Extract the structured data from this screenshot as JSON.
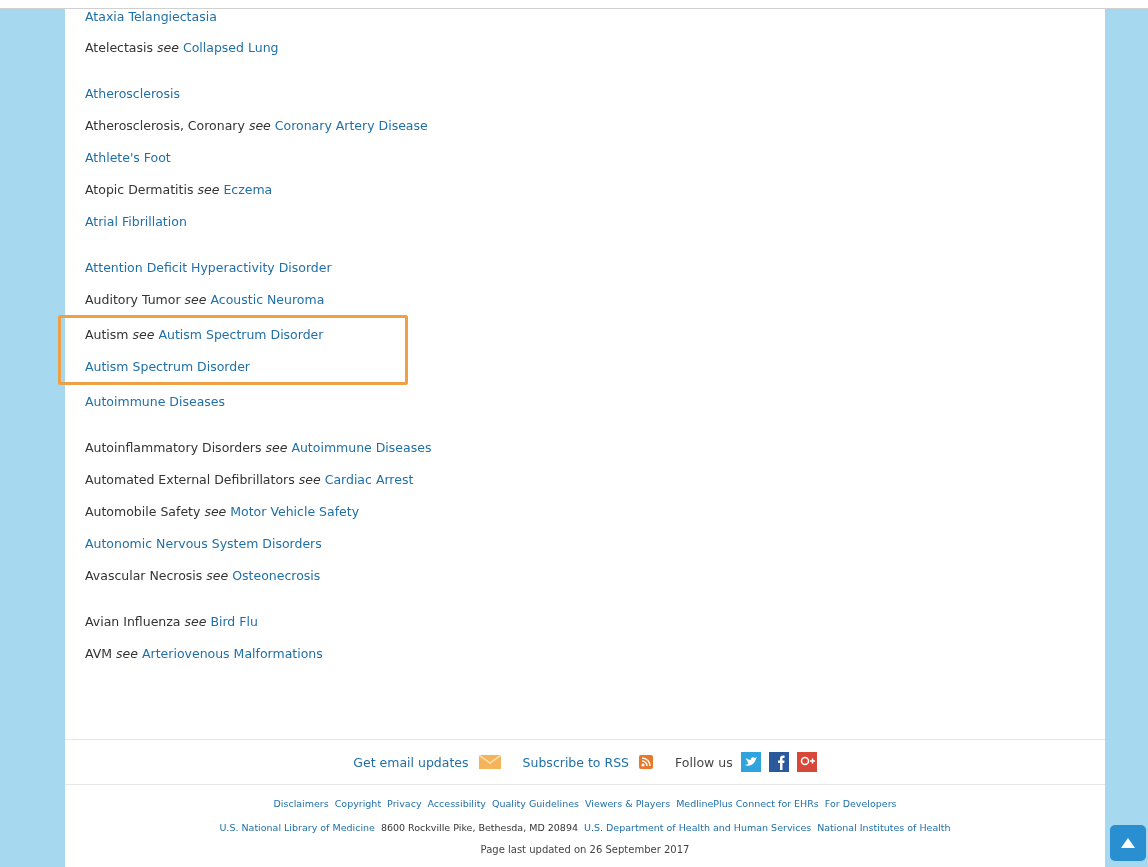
{
  "groups": [
    {
      "items": [
        {
          "term": "Ataxia Telangiectasia",
          "term_is_link": true,
          "highlighted": false
        },
        {
          "term": "Atelectasis",
          "term_is_link": false,
          "see_word": "see",
          "see": "Collapsed Lung",
          "highlighted": false
        }
      ]
    },
    {
      "items": [
        {
          "term": "Atherosclerosis",
          "term_is_link": true,
          "highlighted": false
        },
        {
          "term": "Atherosclerosis, Coronary",
          "term_is_link": false,
          "see_word": "see",
          "see": "Coronary Artery Disease",
          "highlighted": false
        },
        {
          "term": "Athlete's Foot",
          "term_is_link": true,
          "highlighted": false
        },
        {
          "term": "Atopic Dermatitis",
          "term_is_link": false,
          "see_word": "see",
          "see": "Eczema",
          "highlighted": false
        },
        {
          "term": "Atrial Fibrillation",
          "term_is_link": true,
          "highlighted": false
        }
      ]
    },
    {
      "items": [
        {
          "term": "Attention Deficit Hyperactivity Disorder",
          "term_is_link": true,
          "highlighted": false
        },
        {
          "term": "Auditory Tumor",
          "term_is_link": false,
          "see_word": "see",
          "see": "Acoustic Neuroma",
          "highlighted": false
        },
        {
          "term": "Autism",
          "term_is_link": false,
          "see_word": "see",
          "see": "Autism Spectrum Disorder",
          "highlighted": true
        },
        {
          "term": "Autism Spectrum Disorder",
          "term_is_link": true,
          "highlighted": true
        },
        {
          "term": "Autoimmune Diseases",
          "term_is_link": true,
          "highlighted": false
        }
      ]
    },
    {
      "items": [
        {
          "term": "Autoinflammatory Disorders",
          "term_is_link": false,
          "see_word": "see",
          "see": "Autoimmune Diseases",
          "highlighted": false
        },
        {
          "term": "Automated External Defibrillators",
          "term_is_link": false,
          "see_word": "see",
          "see": "Cardiac Arrest",
          "highlighted": false
        },
        {
          "term": "Automobile Safety",
          "term_is_link": false,
          "see_word": "see",
          "see": "Motor Vehicle Safety",
          "highlighted": false
        },
        {
          "term": "Autonomic Nervous System Disorders",
          "term_is_link": true,
          "highlighted": false
        },
        {
          "term": "Avascular Necrosis",
          "term_is_link": false,
          "see_word": "see",
          "see": "Osteonecrosis",
          "highlighted": false
        }
      ]
    },
    {
      "items": [
        {
          "term": "Avian Influenza",
          "term_is_link": false,
          "see_word": "see",
          "see": "Bird Flu",
          "highlighted": false
        },
        {
          "term": "AVM",
          "term_is_link": false,
          "see_word": "see",
          "see": "Arteriovenous Malformations",
          "highlighted": false
        }
      ]
    }
  ],
  "social": {
    "email": "Get email updates",
    "rss": "Subscribe to RSS",
    "follow": "Follow us"
  },
  "footer_links": [
    "Disclaimers",
    "Copyright",
    "Privacy",
    "Accessibility",
    "Quality Guidelines",
    "Viewers & Players",
    "MedlinePlus Connect for EHRs",
    "For Developers"
  ],
  "footer_agencies": [
    {
      "text": "U.S. National Library of Medicine",
      "kind": "link"
    },
    {
      "text": "8600 Rockville Pike, Bethesda, MD 20894",
      "kind": "plain"
    },
    {
      "text": "U.S. Department of Health and Human Services",
      "kind": "link"
    },
    {
      "text": "National Institutes of Health",
      "kind": "link"
    }
  ],
  "last_updated": "Page last updated on 26 September 2017"
}
